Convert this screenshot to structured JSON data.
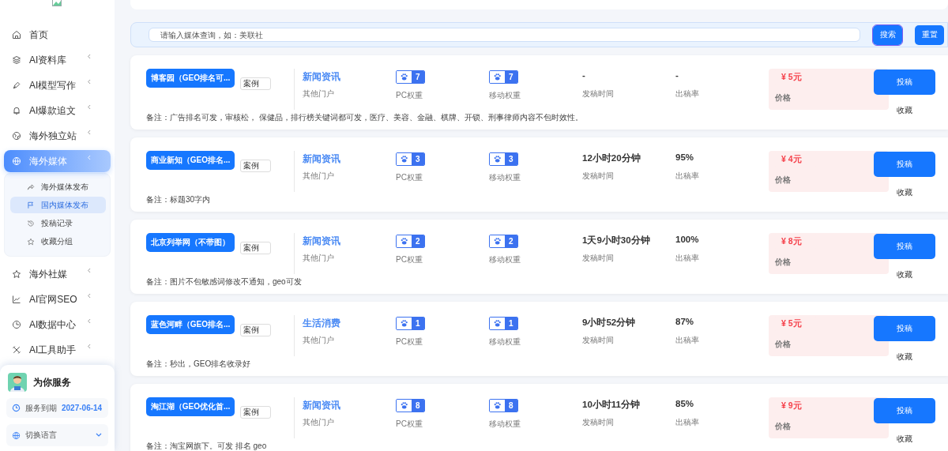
{
  "nav": [
    {
      "label": "首页",
      "expandable": false,
      "selected": false
    },
    {
      "label": "AI资料库",
      "expandable": true,
      "selected": false
    },
    {
      "label": "AI模型写作",
      "expandable": true,
      "selected": false
    },
    {
      "label": "AI爆款追文",
      "expandable": true,
      "selected": false
    },
    {
      "label": "海外独立站",
      "expandable": true,
      "selected": false
    },
    {
      "label": "海外媒体",
      "expandable": true,
      "selected": true,
      "children": [
        {
          "label": "海外媒体发布",
          "selected": false
        },
        {
          "label": "国内媒体发布",
          "selected": true
        },
        {
          "label": "投稿记录",
          "selected": false
        },
        {
          "label": "收藏分组",
          "selected": false
        }
      ]
    },
    {
      "label": "海外社媒",
      "expandable": true,
      "selected": false
    },
    {
      "label": "AI官网SEO",
      "expandable": true,
      "selected": false
    },
    {
      "label": "AI数据中心",
      "expandable": true,
      "selected": false
    },
    {
      "label": "AI工具助手",
      "expandable": true,
      "selected": false
    }
  ],
  "service": {
    "title": "为你服务",
    "expiry_label": "服务到期",
    "expiry_date": "2027-06-14",
    "language_label": "切换语言"
  },
  "search": {
    "placeholder": "请输入媒体查询，如：美联社",
    "buttons": [
      "搜索",
      "重置"
    ]
  },
  "rows": [
    {
      "name": "博客园（GEO排名可...",
      "case": "案例",
      "fields": [
        {
          "kind": "category",
          "value": "新闻资讯",
          "label": "其他门户"
        },
        {
          "kind": "weight",
          "value": "7",
          "label": "PC权重"
        },
        {
          "kind": "weight",
          "value": "7",
          "label": "移动权重"
        },
        {
          "kind": "stat",
          "value": "-",
          "label": "发稿时间"
        },
        {
          "kind": "stat",
          "value": "-",
          "label": "出稿率"
        },
        {
          "kind": "price",
          "value": "¥ 5元",
          "label": "价格"
        }
      ],
      "note": "备注：广告排名可发，审核松， 保健品，排行榜关键词都可发，医疗、美容、金融、棋牌、开锁、刑事律师内容不包时效性。",
      "submit": "投稿",
      "favorite": "收藏"
    },
    {
      "name": "商业新知（GEO排名...",
      "case": "案例",
      "fields": [
        {
          "kind": "category",
          "value": "新闻资讯",
          "label": "其他门户"
        },
        {
          "kind": "weight",
          "value": "3",
          "label": "PC权重"
        },
        {
          "kind": "weight",
          "value": "3",
          "label": "移动权重"
        },
        {
          "kind": "stat",
          "value": "12小时20分钟",
          "label": "发稿时间"
        },
        {
          "kind": "stat",
          "value": "95%",
          "label": "出稿率"
        },
        {
          "kind": "price",
          "value": "¥ 4元",
          "label": "价格"
        }
      ],
      "note": "备注：标题30字内",
      "submit": "投稿",
      "favorite": "收藏"
    },
    {
      "name": "北京列举网（不带图）",
      "case": "案例",
      "fields": [
        {
          "kind": "category",
          "value": "新闻资讯",
          "label": "其他门户"
        },
        {
          "kind": "weight",
          "value": "2",
          "label": "PC权重"
        },
        {
          "kind": "weight",
          "value": "2",
          "label": "移动权重"
        },
        {
          "kind": "stat",
          "value": "1天9小时30分钟",
          "label": "发稿时间"
        },
        {
          "kind": "stat",
          "value": "100%",
          "label": "出稿率"
        },
        {
          "kind": "price",
          "value": "¥ 8元",
          "label": "价格"
        }
      ],
      "note": "备注：图片不包敏感词修改不通知，geo可发",
      "submit": "投稿",
      "favorite": "收藏"
    },
    {
      "name": "蓝色河畔（GEO排名...",
      "case": "案例",
      "fields": [
        {
          "kind": "category",
          "value": "生活消费",
          "label": "其他门户"
        },
        {
          "kind": "weight",
          "value": "1",
          "label": "PC权重"
        },
        {
          "kind": "weight",
          "value": "1",
          "label": "移动权重"
        },
        {
          "kind": "stat",
          "value": "9小时52分钟",
          "label": "发稿时间"
        },
        {
          "kind": "stat",
          "value": "87%",
          "label": "出稿率"
        },
        {
          "kind": "price",
          "value": "¥ 5元",
          "label": "价格"
        }
      ],
      "note": "备注：秒出，GEO排名收录好",
      "submit": "投稿",
      "favorite": "收藏"
    },
    {
      "name": "淘江湖（GEO优化首...",
      "case": "案例",
      "fields": [
        {
          "kind": "category",
          "value": "新闻资讯",
          "label": "其他门户"
        },
        {
          "kind": "weight",
          "value": "8",
          "label": "PC权重"
        },
        {
          "kind": "weight",
          "value": "8",
          "label": "移动权重"
        },
        {
          "kind": "stat",
          "value": "10小时11分钟",
          "label": "发稿时间"
        },
        {
          "kind": "stat",
          "value": "85%",
          "label": "出稿率"
        },
        {
          "kind": "price",
          "value": "¥ 9元",
          "label": "价格"
        }
      ],
      "note": "备注：淘宝网旗下。可发 排名 geo",
      "submit": "投稿",
      "favorite": "收藏"
    }
  ]
}
